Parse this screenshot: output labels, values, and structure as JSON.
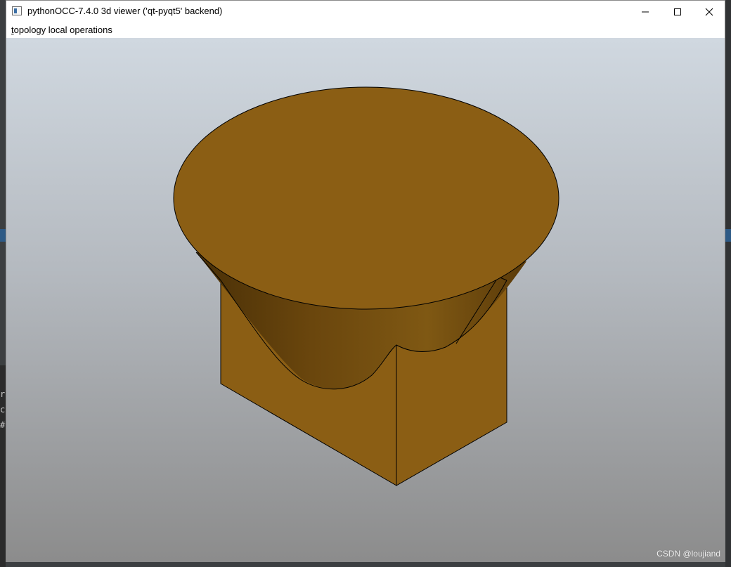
{
  "window": {
    "title": "pythonOCC-7.4.0 3d viewer ('qt-pyqt5' backend)",
    "controls": [
      "minimize-icon",
      "maximize-icon",
      "close-icon"
    ]
  },
  "menubar": {
    "items": [
      {
        "mnemonic": "t",
        "rest": "opology local operations"
      }
    ]
  },
  "backdrop": {
    "left_fragments": [
      "r[",
      "cc",
      "#"
    ]
  },
  "viewer": {
    "model_color": "#8B5E14",
    "edge_color": "#000000",
    "background_top": "#d0d8e0",
    "background_bottom": "#8c8c8c"
  },
  "watermark": "CSDN @loujiand"
}
